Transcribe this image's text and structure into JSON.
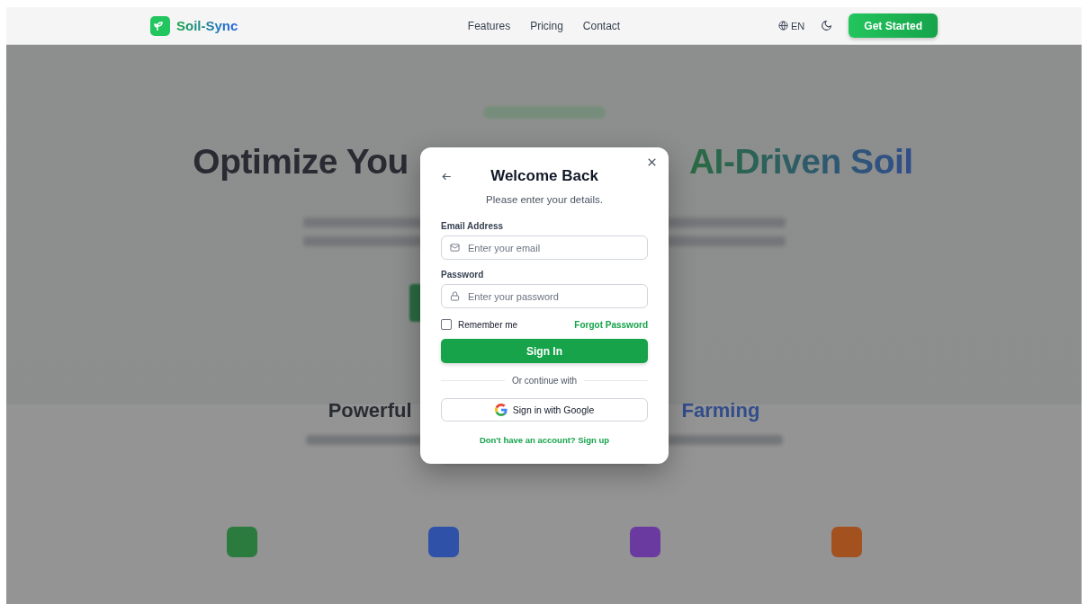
{
  "nav": {
    "brand": "Soil-Sync",
    "links": [
      "Features",
      "Pricing",
      "Contact"
    ],
    "language": "EN",
    "cta": "Get Started"
  },
  "hero": {
    "title_start": "Optimize You",
    "title_end": "AI-Driven Soil"
  },
  "features": {
    "title_start": "Powerful",
    "title_end": "Farming",
    "icons": [
      {
        "color": "#2b7a3e"
      },
      {
        "color": "#2f52a8"
      },
      {
        "color": "#6b3aa0"
      },
      {
        "color": "#a3521f"
      }
    ]
  },
  "modal": {
    "title": "Welcome Back",
    "subtitle": "Please enter your details.",
    "fields": [
      {
        "kind": "email",
        "label": "Email Address",
        "placeholder": "Enter your email"
      },
      {
        "kind": "password",
        "label": "Password",
        "placeholder": "Enter your password"
      }
    ],
    "remember": {
      "label": "Remember me",
      "checked": false
    },
    "forgot": "Forgot Password",
    "submit": "Sign In",
    "divider": "Or continue with",
    "google": "Sign in with Google",
    "signup": "Don't have an account? Sign up"
  }
}
